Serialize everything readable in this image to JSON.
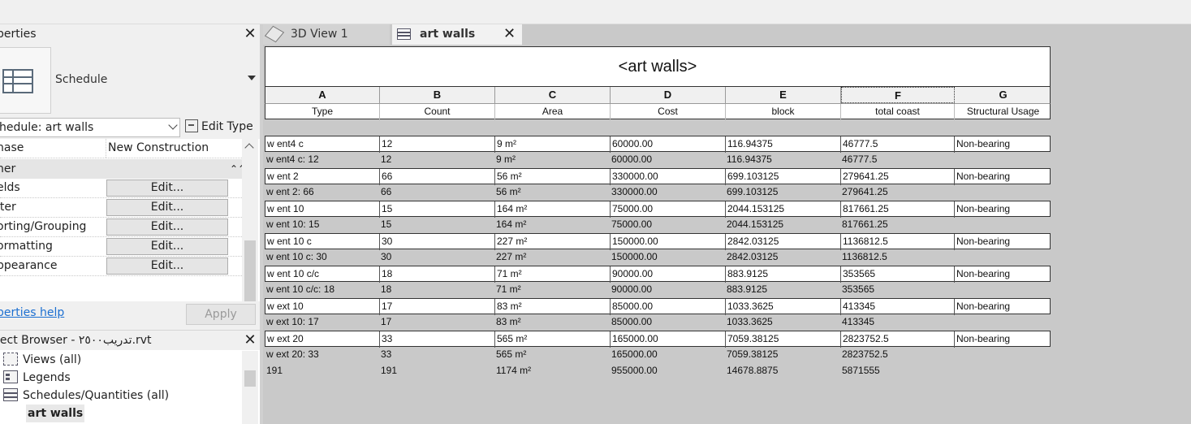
{
  "properties": {
    "title": "perties",
    "type_name": "Schedule",
    "selector": "hedule: art walls",
    "edit_type": "Edit Type",
    "rows": [
      {
        "key": "hase",
        "value": "New Construction"
      }
    ],
    "group": "her",
    "group_collapse": "⌃⌃",
    "params": [
      {
        "key": "elds",
        "button": "Edit..."
      },
      {
        "key": "lter",
        "button": "Edit..."
      },
      {
        "key": "orting/Grouping",
        "button": "Edit..."
      },
      {
        "key": "ormatting",
        "button": "Edit..."
      },
      {
        "key": "ppearance",
        "button": "Edit..."
      }
    ],
    "help": "perties help",
    "apply": "Apply",
    "close": "✕"
  },
  "browser": {
    "title": "ject Browser - تدريب٢٥٠٠.rvt",
    "close": "✕",
    "items": [
      {
        "label": "Views (all)",
        "icon": "views-icon"
      },
      {
        "label": "Legends",
        "icon": "legends-icon"
      },
      {
        "label": "Schedules/Quantities (all)",
        "icon": "schedule-icon"
      },
      {
        "label": "art walls",
        "icon": ""
      }
    ]
  },
  "tabs": [
    {
      "label": "3D View 1",
      "icon": "3d-cube-icon"
    },
    {
      "label": "art walls",
      "icon": "schedule-icon",
      "close": "✕"
    }
  ],
  "schedule": {
    "title": "<art walls>",
    "letters": [
      "A",
      "B",
      "C",
      "D",
      "E",
      "F",
      "G"
    ],
    "headers": [
      "Type",
      "Count",
      "Area",
      "Cost",
      "block",
      "total coast",
      "Structural Usage"
    ],
    "rows": [
      {
        "kind": "item",
        "cells": [
          "w ent4 c",
          "12",
          "9 m²",
          "60000.00",
          "116.94375",
          "46777.5",
          "Non-bearing"
        ]
      },
      {
        "kind": "group",
        "cells": [
          "w ent4 c: 12",
          "12",
          "9 m²",
          "60000.00",
          "116.94375",
          "46777.5",
          ""
        ]
      },
      {
        "kind": "item",
        "cells": [
          "w ent 2",
          "66",
          "56 m²",
          "330000.00",
          "699.103125",
          "279641.25",
          "Non-bearing"
        ]
      },
      {
        "kind": "group",
        "cells": [
          "w ent 2: 66",
          "66",
          "56 m²",
          "330000.00",
          "699.103125",
          "279641.25",
          ""
        ]
      },
      {
        "kind": "item",
        "cells": [
          "w ent 10",
          "15",
          "164 m²",
          "75000.00",
          "2044.153125",
          "817661.25",
          "Non-bearing"
        ]
      },
      {
        "kind": "group",
        "cells": [
          "w ent 10: 15",
          "15",
          "164 m²",
          "75000.00",
          "2044.153125",
          "817661.25",
          ""
        ]
      },
      {
        "kind": "item",
        "cells": [
          "w ent 10 c",
          "30",
          "227 m²",
          "150000.00",
          "2842.03125",
          "1136812.5",
          "Non-bearing"
        ]
      },
      {
        "kind": "group",
        "cells": [
          "w ent 10 c: 30",
          "30",
          "227 m²",
          "150000.00",
          "2842.03125",
          "1136812.5",
          ""
        ]
      },
      {
        "kind": "item",
        "cells": [
          "w ent 10 c/c",
          "18",
          "71 m²",
          "90000.00",
          "883.9125",
          "353565",
          "Non-bearing"
        ]
      },
      {
        "kind": "group",
        "cells": [
          "w ent 10 c/c: 18",
          "18",
          "71 m²",
          "90000.00",
          "883.9125",
          "353565",
          ""
        ]
      },
      {
        "kind": "item",
        "cells": [
          "w ext 10",
          "17",
          "83 m²",
          "85000.00",
          "1033.3625",
          "413345",
          "Non-bearing"
        ]
      },
      {
        "kind": "group",
        "cells": [
          "w ext 10: 17",
          "17",
          "83 m²",
          "85000.00",
          "1033.3625",
          "413345",
          ""
        ]
      },
      {
        "kind": "item",
        "cells": [
          "w ext 20",
          "33",
          "565 m²",
          "165000.00",
          "7059.38125",
          "2823752.5",
          "Non-bearing"
        ]
      },
      {
        "kind": "group",
        "cells": [
          "w ext 20: 33",
          "33",
          "565 m²",
          "165000.00",
          "7059.38125",
          "2823752.5",
          ""
        ]
      },
      {
        "kind": "total",
        "cells": [
          "191",
          "191",
          "1174 m²",
          "955000.00",
          "14678.8875",
          "5871555",
          ""
        ]
      }
    ]
  }
}
